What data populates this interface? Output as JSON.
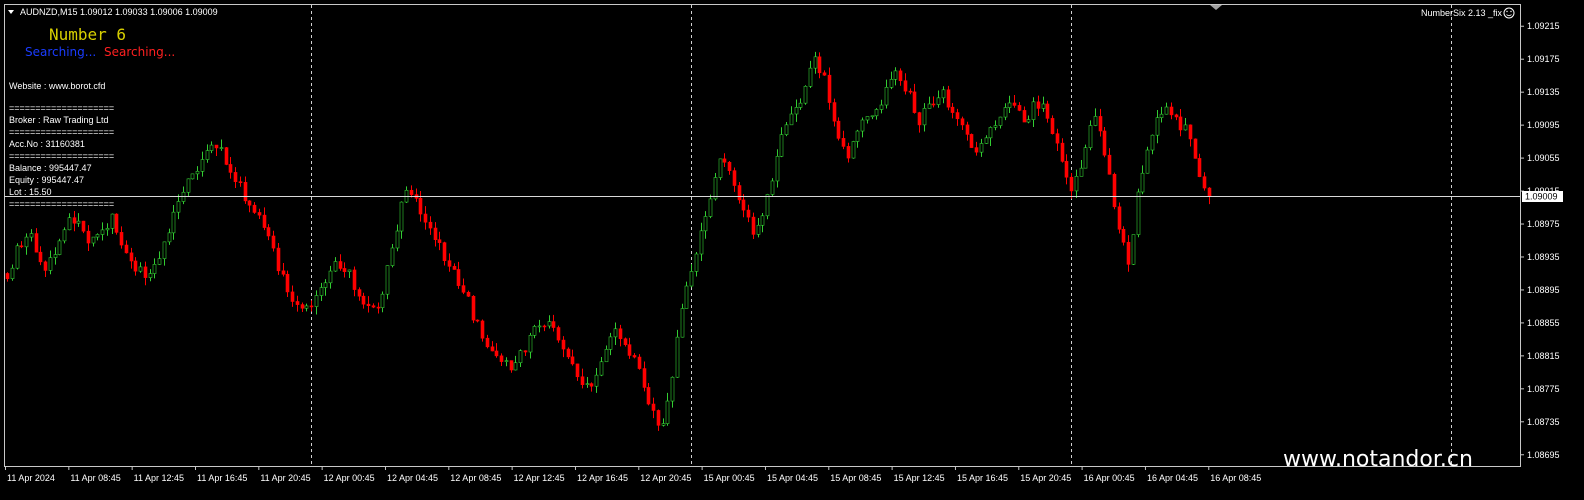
{
  "header": {
    "symbol_line": "AUDNZD,M15  1.09012 1.09033 1.09006 1.09009",
    "indicator_label": "NumberSix 2.13 _fix"
  },
  "ea_panel": {
    "title": "Number 6",
    "status_a": "Searching...",
    "status_b": "Searching...",
    "website": "Website :  www.borot.cfd",
    "separator": "====================",
    "broker": " Broker  : Raw Trading Ltd",
    "account": " Acc.No  : 31160381",
    "balance": "Balance : 995447.47",
    "equity": "Equity    : 995447.47",
    "lot": "Lot   : 15.50"
  },
  "watermark": "www.notandor.cn",
  "price_axis": {
    "ticks": [
      "1.09215",
      "1.09175",
      "1.09135",
      "1.09095",
      "1.09055",
      "1.09015",
      "1.08975",
      "1.08935",
      "1.08895",
      "1.08855",
      "1.08815",
      "1.08775",
      "1.08735",
      "1.08695"
    ],
    "current_price": "1.09009"
  },
  "time_axis": {
    "ticks": [
      "11 Apr 2024",
      "11 Apr 08:45",
      "11 Apr 12:45",
      "11 Apr 16:45",
      "11 Apr 20:45",
      "12 Apr 00:45",
      "12 Apr 04:45",
      "12 Apr 08:45",
      "12 Apr 12:45",
      "12 Apr 16:45",
      "12 Apr 20:45",
      "15 Apr 00:45",
      "15 Apr 04:45",
      "15 Apr 08:45",
      "15 Apr 12:45",
      "15 Apr 16:45",
      "15 Apr 20:45",
      "16 Apr 00:45",
      "16 Apr 04:45",
      "16 Apr 08:45"
    ]
  },
  "colors": {
    "background": "#000000",
    "bull": "#32cd32",
    "bear": "#ff0000",
    "grid": "#c8c8c8"
  },
  "chart_data": {
    "type": "candlestick",
    "symbol": "AUDNZD",
    "timeframe": "M15",
    "ylim": [
      1.08685,
      1.09225
    ],
    "last_close": 1.09009,
    "path_y": [
      1.08915,
      1.0895,
      1.0896,
      1.0892,
      1.0894,
      1.0897,
      1.0899,
      1.08955,
      1.0897,
      1.0898,
      1.0894,
      1.0892,
      1.0891,
      1.0893,
      1.0898,
      1.0902,
      1.0903,
      1.0906,
      1.0907,
      1.0904,
      1.0902,
      1.0899,
      1.0897,
      1.0893,
      1.0889,
      1.0888,
      1.0887,
      1.089,
      1.0893,
      1.0892,
      1.0889,
      1.0887,
      1.0888,
      1.0895,
      1.0902,
      1.0901,
      1.0897,
      1.0895,
      1.0892,
      1.089,
      1.0886,
      1.0883,
      1.0881,
      1.088,
      1.0882,
      1.0884,
      1.0886,
      1.0884,
      1.0881,
      1.0879,
      1.0878,
      1.0881,
      1.0885,
      1.0883,
      1.088,
      1.0876,
      1.0872,
      1.088,
      1.0889,
      1.0894,
      1.09,
      1.0905,
      1.0904,
      1.0899,
      1.0896,
      1.09,
      1.0907,
      1.091,
      1.0913,
      1.0918,
      1.0915,
      1.0909,
      1.0906,
      1.0909,
      1.0911,
      1.0913,
      1.0916,
      1.0914,
      1.091,
      1.0912,
      1.0914,
      1.0911,
      1.0908,
      1.0906,
      1.0908,
      1.0911,
      1.0913,
      1.0909,
      1.0912,
      1.0911,
      1.0907,
      1.0901,
      1.0905,
      1.0911,
      1.0906,
      1.0898,
      1.0893,
      1.0903,
      1.0908,
      1.0912,
      1.091,
      1.0909,
      1.0904,
      1.09009
    ]
  }
}
